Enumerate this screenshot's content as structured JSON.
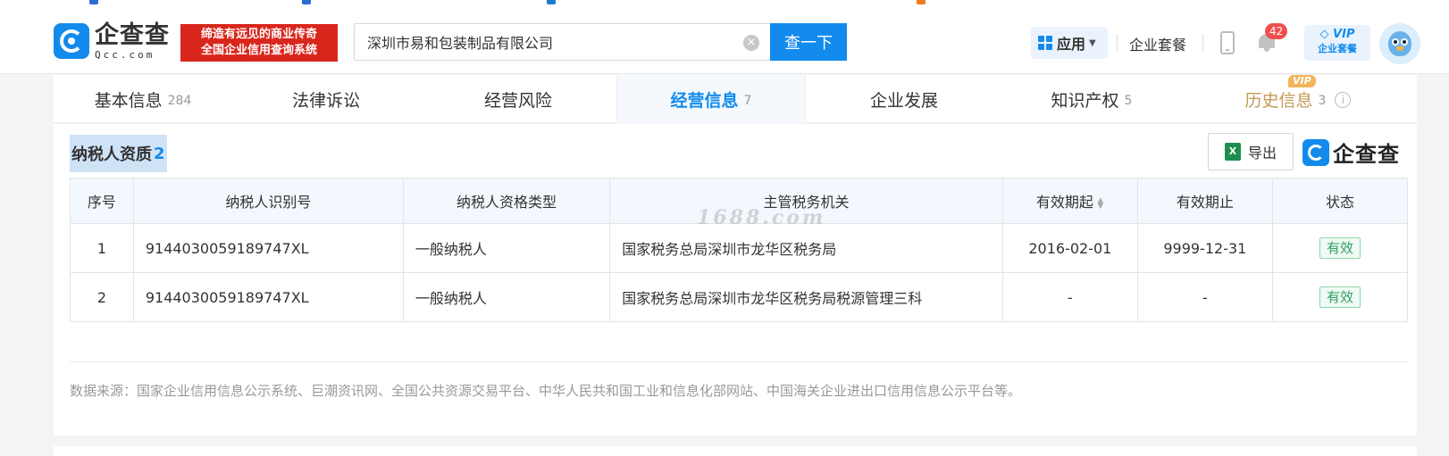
{
  "header": {
    "logo_cn": "企查查",
    "logo_en": "Qcc.com",
    "slogan_line1": "缔造有远见的商业传奇",
    "slogan_line2": "全国企业信用查询系统",
    "search_value": "深圳市易和包装制品有限公司",
    "search_button": "查一下",
    "apps_label": "应用",
    "enterprise_package": "企业套餐",
    "notification_count": "42",
    "vip_label": "VIP",
    "vip_sub": "企业套餐"
  },
  "tabs": [
    {
      "label": "基本信息",
      "count": "284"
    },
    {
      "label": "法律诉讼",
      "count": ""
    },
    {
      "label": "经营风险",
      "count": ""
    },
    {
      "label": "经营信息",
      "count": "7"
    },
    {
      "label": "企业发展",
      "count": ""
    },
    {
      "label": "知识产权",
      "count": "5"
    },
    {
      "label": "历史信息",
      "count": "3",
      "tag": "VIP"
    }
  ],
  "section": {
    "title": "纳税人资质",
    "count": "2",
    "export_label": "导出",
    "brand_text": "企查查"
  },
  "table": {
    "headers": [
      "序号",
      "纳税人识别号",
      "纳税人资格类型",
      "主管税务机关",
      "有效期起",
      "有效期止",
      "状态"
    ],
    "rows": [
      [
        "1",
        "9144030059189747XL",
        "一般纳税人",
        "国家税务总局深圳市龙华区税务局",
        "2016-02-01",
        "9999-12-31",
        "有效"
      ],
      [
        "2",
        "9144030059189747XL",
        "一般纳税人",
        "国家税务总局深圳市龙华区税务局税源管理三科",
        "-",
        "-",
        "有效"
      ]
    ]
  },
  "watermark": "1688.com",
  "source_note": "数据来源：国家企业信用信息公示系统、巨潮资讯网、全国公共资源交易平台、中华人民共和国工业和信息化部网站、中国海关企业进出口信用信息公示平台等。",
  "colors": {
    "accent": "#128bed",
    "slogan_bg": "#d9261c",
    "status_green": "#2e9f62",
    "vip_gold": "#c29a55"
  }
}
